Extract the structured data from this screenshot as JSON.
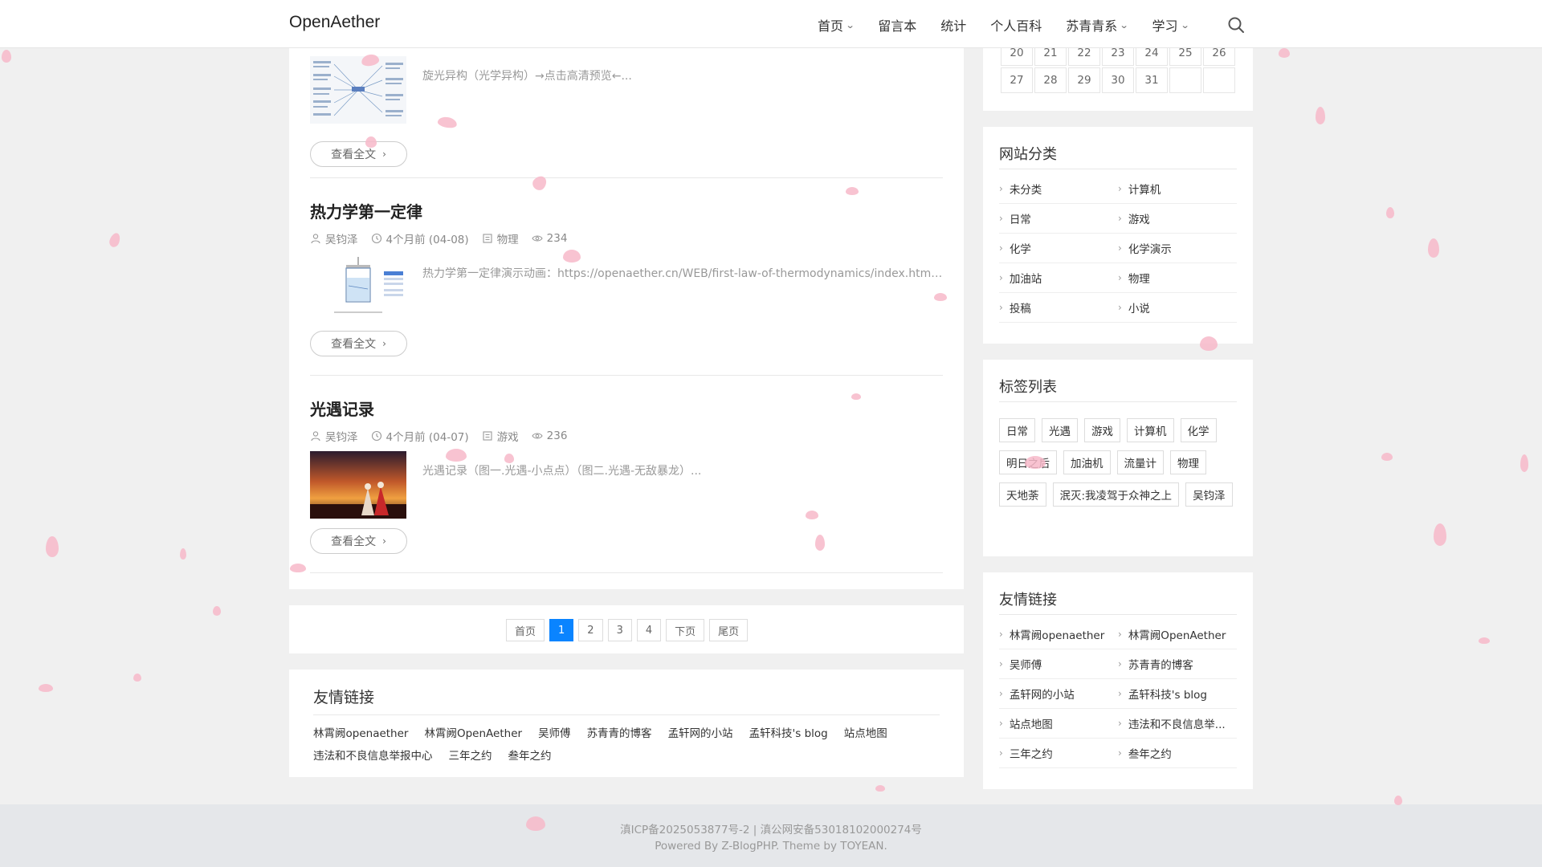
{
  "header": {
    "brand": "OpenAether",
    "nav": [
      {
        "label": "首页",
        "has_dropdown": true
      },
      {
        "label": "留言本",
        "has_dropdown": false
      },
      {
        "label": "统计",
        "has_dropdown": false
      },
      {
        "label": "个人百科",
        "has_dropdown": false
      },
      {
        "label": "苏青青系",
        "has_dropdown": true
      },
      {
        "label": "学习",
        "has_dropdown": true
      }
    ],
    "search_icon": "search-icon"
  },
  "posts": [
    {
      "title": "",
      "excerpt": "旋光异构（光学异构）→点击高清预览←...",
      "thumb": "mindmap",
      "more_label": "查看全文"
    },
    {
      "title": "热力学第一定律",
      "author": "吴钧泽",
      "time": "4个月前 (04-08)",
      "category": "物理",
      "views": "234",
      "excerpt": "热力学第一定律演示动画：https://openaether.cn/WEB/first-law-of-thermodynamics/index.html...",
      "thumb": "diagram",
      "more_label": "查看全文"
    },
    {
      "title": "光遇记录",
      "author": "吴钧泽",
      "time": "4个月前 (04-07)",
      "category": "游戏",
      "views": "236",
      "excerpt": "光遇记录（图一.光遇-小点点）（图二.光遇-无敌暴龙）...",
      "thumb": "sunset",
      "more_label": "查看全文"
    }
  ],
  "pagination": {
    "items": [
      "首页",
      "1",
      "2",
      "3",
      "4",
      "下页",
      "尾页"
    ],
    "active": "1"
  },
  "main_links": {
    "title": "友情链接",
    "items": [
      "林霄阙openaether",
      "林霄阙OpenAether",
      "吴师傅",
      "苏青青的博客",
      "孟轩网的小站",
      "孟轩科技's blog",
      "站点地图",
      "违法和不良信息举报中心",
      "三年之约",
      "叁年之约"
    ]
  },
  "calendar": {
    "rows": [
      [
        "20",
        "21",
        "22",
        "23",
        "24",
        "25",
        "26"
      ],
      [
        "27",
        "28",
        "29",
        "30",
        "31",
        "",
        ""
      ]
    ]
  },
  "categories": {
    "title": "网站分类",
    "items": [
      "未分类",
      "计算机",
      "日常",
      "游戏",
      "化学",
      "化学演示",
      "加油站",
      "物理",
      "投稿",
      "小说"
    ]
  },
  "tags": {
    "title": "标签列表",
    "items": [
      "日常",
      "光遇",
      "游戏",
      "计算机",
      "化学",
      "明日之后",
      "加油机",
      "流量计",
      "物理",
      "天地荼",
      "泯灭:我凌驾于众神之上",
      "吴钧泽"
    ]
  },
  "side_links": {
    "title": "友情链接",
    "items": [
      "林霄阙openaether",
      "林霄阙OpenAether",
      "吴师傅",
      "苏青青的博客",
      "孟轩网的小站",
      "孟轩科技's blog",
      "站点地图",
      "违法和不良信息举...",
      "三年之约",
      "叁年之约"
    ]
  },
  "footer": {
    "line1": "滇ICP备2025053877号-2 | 滇公网安备53018102000274号",
    "line2": "Powered By Z-BlogPHP. Theme by TOYEAN."
  },
  "colors": {
    "accent": "#0a84ff",
    "petal": "#f7b8c9"
  }
}
